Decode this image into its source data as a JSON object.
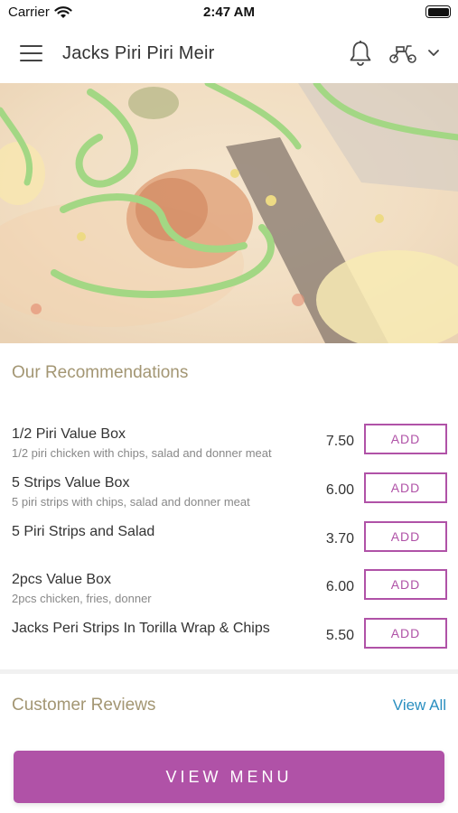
{
  "status_bar": {
    "carrier": "Carrier",
    "time": "2:47 AM"
  },
  "header": {
    "title": "Jacks Piri Piri Meir",
    "icons": [
      "menu-icon",
      "bell-icon",
      "scooter-icon",
      "chevron-down-icon"
    ]
  },
  "recommendations": {
    "title": "Our Recommendations",
    "items": [
      {
        "name": "1/2 Piri Value Box",
        "desc": "1/2 piri chicken with chips, salad and donner meat",
        "price": "7.50",
        "add_label": "ADD"
      },
      {
        "name": "5 Strips Value Box",
        "desc": "5 piri strips with chips, salad and donner meat",
        "price": "6.00",
        "add_label": "ADD"
      },
      {
        "name": "5 Piri Strips and Salad",
        "desc": "",
        "price": "3.70",
        "add_label": "ADD"
      },
      {
        "name": "2pcs Value Box",
        "desc": "2pcs chicken, fries, donner",
        "price": "6.00",
        "add_label": "ADD"
      },
      {
        "name": "Jacks Peri Strips In Torilla Wrap & Chips",
        "desc": "",
        "price": "5.50",
        "add_label": "ADD"
      }
    ]
  },
  "reviews": {
    "title": "Customer Reviews",
    "view_all": "View All"
  },
  "footer": {
    "button_label": "VIEW MENU"
  },
  "colors": {
    "accent": "#b052a7",
    "section_title": "#a39673",
    "link": "#2a8fc0"
  }
}
